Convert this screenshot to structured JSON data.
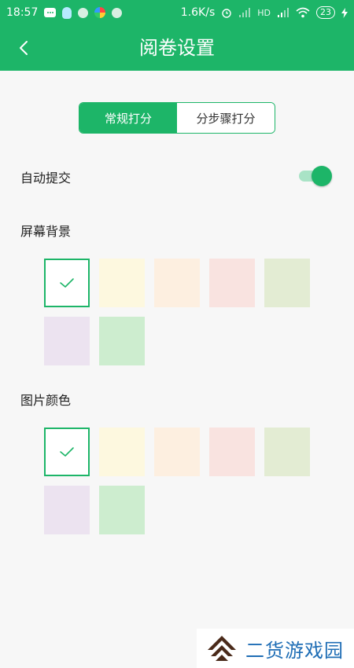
{
  "status_bar": {
    "time": "18:57",
    "speed": "1.6K/s",
    "hd": "HD",
    "battery": "23"
  },
  "app_bar": {
    "title": "阅卷设置"
  },
  "mode_tabs": [
    {
      "label": "常规打分",
      "active": true
    },
    {
      "label": "分步骤打分",
      "active": false
    }
  ],
  "auto_submit": {
    "label": "自动提交",
    "enabled": true
  },
  "screen_background": {
    "label": "屏幕背景",
    "selected_index": 0,
    "colors": [
      "#ffffff",
      "#fdf8df",
      "#fdefe0",
      "#f9e3e0",
      "#e3ecd3",
      "#ece3f0",
      "#cdedcf"
    ]
  },
  "image_color": {
    "label": "图片颜色",
    "selected_index": 0,
    "colors": [
      "#ffffff",
      "#fdf8df",
      "#fdefe0",
      "#f9e3e0",
      "#e3ecd3",
      "#ece3f0",
      "#cdedcf"
    ]
  },
  "watermark": {
    "text": "二货游戏园"
  },
  "theme": {
    "accent": "#1db568"
  }
}
